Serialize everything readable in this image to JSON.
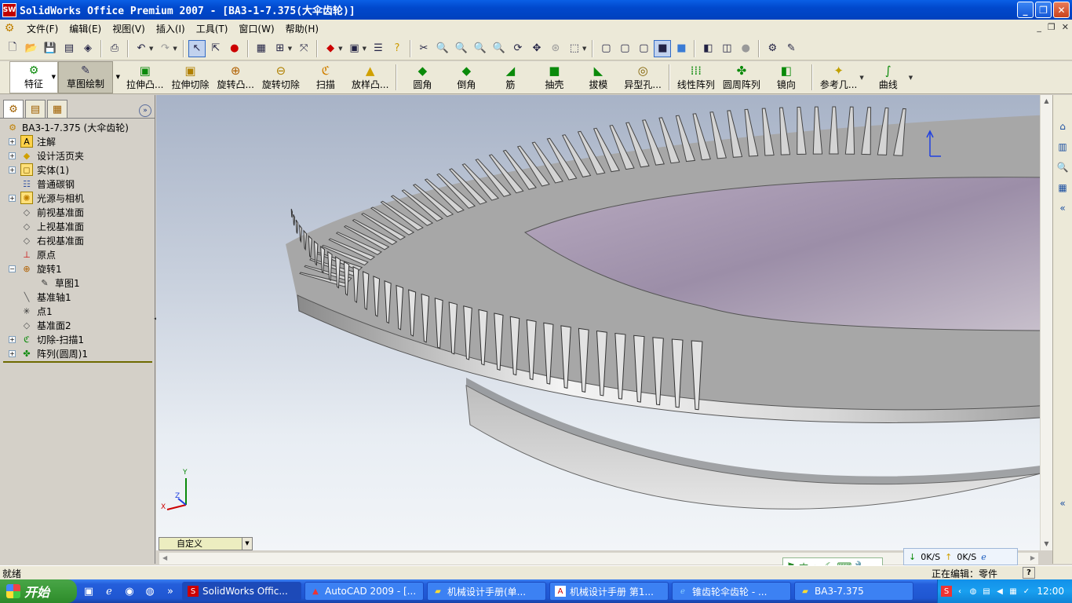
{
  "window": {
    "app_icon": "SW",
    "title": "SolidWorks Office Premium 2007 - [BA3-1-7.375(大伞齿轮)]",
    "minimize": "_",
    "maximize": "❐",
    "close": "✕"
  },
  "menubar": {
    "items": [
      "文件(F)",
      "编辑(E)",
      "视图(V)",
      "插入(I)",
      "工具(T)",
      "窗口(W)",
      "帮助(H)"
    ],
    "doc_controls": [
      "_",
      "❐",
      "✕"
    ]
  },
  "command_manager": {
    "tabs": [
      {
        "label": "特征",
        "icon": "features-icon"
      },
      {
        "label": "草图绘制",
        "icon": "sketch-icon"
      }
    ],
    "buttons": [
      "拉伸凸...",
      "拉伸切除",
      "旋转凸...",
      "旋转切除",
      "扫描",
      "放样凸...",
      "圆角",
      "倒角",
      "筋",
      "抽壳",
      "拔模",
      "异型孔...",
      "线性阵列",
      "圆周阵列",
      "镜向",
      "参考几...",
      "曲线"
    ]
  },
  "feature_tree": {
    "root": "BA3-1-7.375 (大伞齿轮)",
    "items": [
      {
        "label": "注解",
        "icon": "annotation-icon",
        "expander": "+"
      },
      {
        "label": "设计活页夹",
        "icon": "design-binder-icon",
        "expander": "+"
      },
      {
        "label": "实体(1)",
        "icon": "solid-bodies-icon",
        "expander": "+"
      },
      {
        "label": "普通碳钢",
        "icon": "material-icon",
        "expander": ""
      },
      {
        "label": "光源与相机",
        "icon": "lights-cameras-icon",
        "expander": "+"
      },
      {
        "label": "前视基准面",
        "icon": "plane-icon",
        "expander": ""
      },
      {
        "label": "上视基准面",
        "icon": "plane-icon",
        "expander": ""
      },
      {
        "label": "右视基准面",
        "icon": "plane-icon",
        "expander": ""
      },
      {
        "label": "原点",
        "icon": "origin-icon",
        "expander": ""
      },
      {
        "label": "旋转1",
        "icon": "revolve-icon",
        "expander": "−"
      },
      {
        "label": "基准轴1",
        "icon": "axis-icon",
        "expander": ""
      },
      {
        "label": "点1",
        "icon": "point-icon",
        "expander": ""
      },
      {
        "label": "基准面2",
        "icon": "plane-icon",
        "expander": ""
      },
      {
        "label": "切除-扫描1",
        "icon": "swept-cut-icon",
        "expander": "+"
      },
      {
        "label": "阵列(圆周)1",
        "icon": "circular-pattern-icon",
        "expander": "+"
      }
    ],
    "child_of_revolve": "草图1"
  },
  "viewport": {
    "view_selector": "自定义",
    "triad": {
      "x": "X",
      "y": "Y",
      "z": "Z"
    }
  },
  "netspeed": {
    "down": "0K/S",
    "up": "0K/S"
  },
  "ime": {
    "mode": "中"
  },
  "statusbar": {
    "left": "就绪",
    "right": "正在编辑：零件",
    "help": "?"
  },
  "taskbar": {
    "start": "开始",
    "tasks": [
      {
        "label": "SolidWorks Offic...",
        "icon": "solidworks-icon",
        "active": true
      },
      {
        "label": "AutoCAD 2009 - [...",
        "icon": "autocad-icon",
        "active": false
      },
      {
        "label": "机械设计手册(单...",
        "icon": "folder-icon",
        "active": false
      },
      {
        "label": "机械设计手册 第1...",
        "icon": "pdf-icon",
        "active": false
      },
      {
        "label": "锥齿轮伞齿轮 - ...",
        "icon": "ie-icon",
        "active": false
      },
      {
        "label": "BA3-7.375",
        "icon": "folder-icon",
        "active": false
      }
    ],
    "clock": "12:00"
  },
  "colors": {
    "titlebar": "#0148cc",
    "taskbar": "#245edb",
    "start": "#3b9a38",
    "viewport_top": "#a8b3c7",
    "viewport_bottom": "#f2f5f8"
  }
}
